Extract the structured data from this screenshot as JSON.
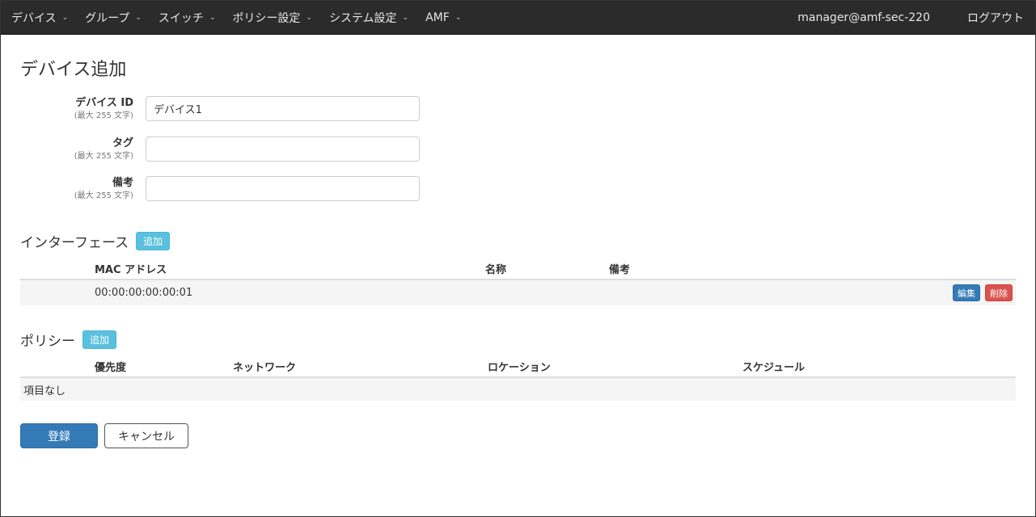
{
  "navbar": {
    "items": [
      {
        "label": "デバイス"
      },
      {
        "label": "グループ"
      },
      {
        "label": "スイッチ"
      },
      {
        "label": "ポリシー設定"
      },
      {
        "label": "システム設定"
      },
      {
        "label": "AMF"
      }
    ],
    "caret": "⌄",
    "user": "manager@amf-sec-220",
    "logout": "ログアウト"
  },
  "page": {
    "title": "デバイス追加"
  },
  "form": {
    "device_id": {
      "label": "デバイス ID",
      "hint": "(最大 255 文字)",
      "value": "デバイス1"
    },
    "tag": {
      "label": "タグ",
      "hint": "(最大 255 文字)",
      "value": ""
    },
    "note": {
      "label": "備考",
      "hint": "(最大 255 文字)",
      "value": ""
    }
  },
  "interfaces": {
    "title": "インターフェース",
    "add_label": "追加",
    "columns": {
      "mac": "MAC アドレス",
      "name": "名称",
      "note": "備考"
    },
    "rows": [
      {
        "mac": "00:00:00:00:00:01",
        "name": "",
        "note": "",
        "edit_label": "編集",
        "delete_label": "削除"
      }
    ]
  },
  "policies": {
    "title": "ポリシー",
    "add_label": "追加",
    "columns": {
      "priority": "優先度",
      "network": "ネットワーク",
      "location": "ロケーション",
      "schedule": "スケジュール"
    },
    "empty_text": "項目なし"
  },
  "actions": {
    "submit_label": "登録",
    "cancel_label": "キャンセル"
  },
  "colors": {
    "navbar_bg": "#2b2b2b",
    "primary": "#337ab7",
    "info": "#5bc0de",
    "danger": "#d9534f"
  }
}
